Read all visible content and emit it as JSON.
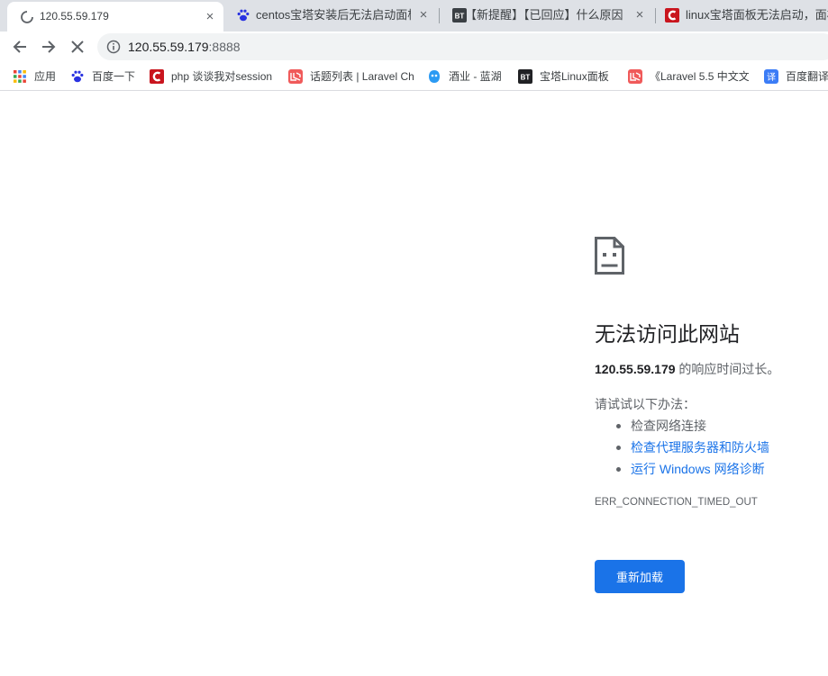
{
  "tabs": [
    {
      "title": "120.55.59.179",
      "icon": "loading-spinner-icon",
      "active": true
    },
    {
      "title": "centos宝塔安装后无法启动面板",
      "icon": "baidu-paw-icon",
      "active": false
    },
    {
      "title": "【新提醒】【已回应】什么原因",
      "icon": "bt-icon",
      "active": false
    },
    {
      "title": "linux宝塔面板无法启动，面板",
      "icon": "csdn-icon",
      "active": false
    }
  ],
  "tab_close_glyph": "×",
  "omnibox": {
    "host": "120.55.59.179",
    "port": ":8888"
  },
  "bookmarks": [
    {
      "label": "应用",
      "icon": "apps-grid-icon"
    },
    {
      "label": "百度一下",
      "icon": "baidu-paw-icon"
    },
    {
      "label": "php 谈谈我对session",
      "icon": "csdn-icon"
    },
    {
      "label": "话题列表 | Laravel Ch",
      "icon": "laravel-icon"
    },
    {
      "label": "酒业 - 蓝湖",
      "icon": "lanhu-icon"
    },
    {
      "label": "宝塔Linux面板",
      "icon": "bt-icon"
    },
    {
      "label": "《Laravel 5.5 中文文",
      "icon": "laravel-icon"
    },
    {
      "label": "百度翻译",
      "icon": "baidu-translate-icon"
    }
  ],
  "error": {
    "title": "无法访问此网站",
    "host": "120.55.59.179",
    "desc_suffix": " 的响应时间过长。",
    "try_label": "请试试以下办法：",
    "suggestions": [
      {
        "text": "检查网络连接",
        "link": false
      },
      {
        "text": "检查代理服务器和防火墙",
        "link": true
      },
      {
        "text": "运行 Windows 网络诊断",
        "link": true
      }
    ],
    "code": "ERR_CONNECTION_TIMED_OUT",
    "reload_label": "重新加载"
  },
  "colors": {
    "accent": "#1a73e8",
    "tabstrip": "#dee1e6",
    "omnibox": "#f1f3f4"
  }
}
